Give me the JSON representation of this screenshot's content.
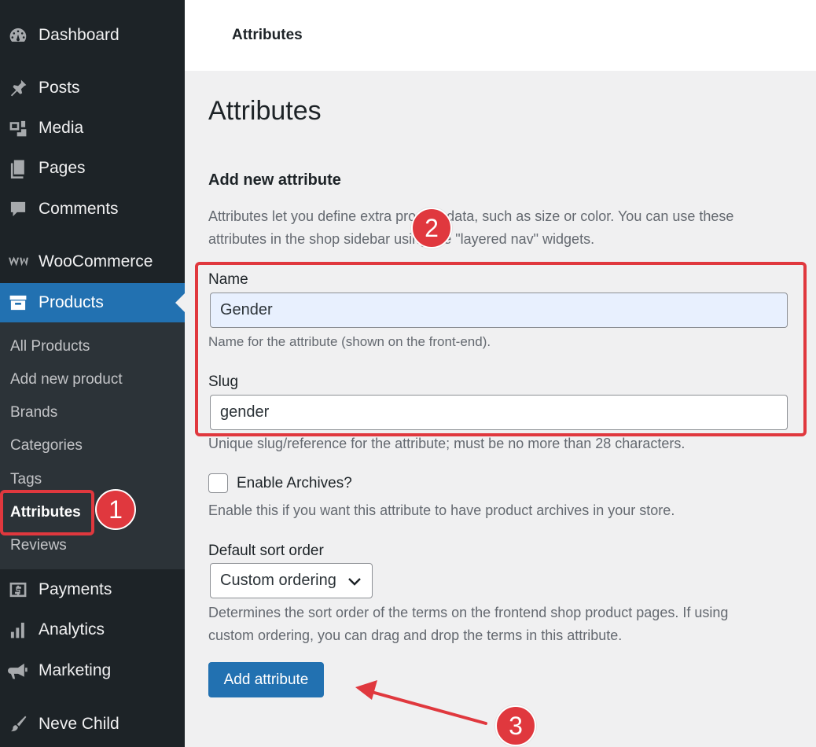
{
  "sidebar": {
    "items": [
      {
        "label": "Dashboard",
        "icon": "dashboard-icon"
      },
      {
        "label": "Posts",
        "icon": "pin-icon"
      },
      {
        "label": "Media",
        "icon": "media-icon"
      },
      {
        "label": "Pages",
        "icon": "pages-icon"
      },
      {
        "label": "Comments",
        "icon": "comment-icon"
      },
      {
        "label": "WooCommerce",
        "icon": "woocommerce-icon"
      },
      {
        "label": "Products",
        "icon": "archive-icon"
      },
      {
        "label": "Payments",
        "icon": "dollar-icon"
      },
      {
        "label": "Analytics",
        "icon": "chart-bar-icon"
      },
      {
        "label": "Marketing",
        "icon": "megaphone-icon"
      },
      {
        "label": "Neve Child",
        "icon": "brush-icon"
      }
    ],
    "submenu": [
      {
        "label": "All Products"
      },
      {
        "label": "Add new product"
      },
      {
        "label": "Brands"
      },
      {
        "label": "Categories"
      },
      {
        "label": "Tags"
      },
      {
        "label": "Attributes"
      },
      {
        "label": "Reviews"
      }
    ]
  },
  "topbar": {
    "title": "Attributes"
  },
  "main": {
    "title": "Attributes",
    "section_title": "Add new attribute",
    "intro_line1": "Attributes let you define extra product data, such as size or color. You can use these",
    "intro_line2": "attributes in the shop sidebar using the \"layered nav\" widgets.",
    "name_label": "Name",
    "name_value": "Gender",
    "name_help": "Name for the attribute (shown on the front-end).",
    "slug_label": "Slug",
    "slug_value": "gender",
    "slug_help": "Unique slug/reference for the attribute; must be no more than 28 characters.",
    "archives_label": "Enable Archives?",
    "archives_checked": false,
    "archives_help": "Enable this if you want this attribute to have product archives in your store.",
    "sort_label": "Default sort order",
    "sort_value": "Custom ordering",
    "sort_help_line1": "Determines the sort order of the terms on the frontend shop product pages. If using",
    "sort_help_line2": "custom ordering, you can drag and drop the terms in this attribute.",
    "submit_label": "Add attribute"
  },
  "annotations": {
    "badge1": "1",
    "badge2": "2",
    "badge3": "3",
    "color": "#e0383e"
  },
  "colors": {
    "sidebar_bg": "#1d2327",
    "submenu_bg": "#2c3338",
    "accent": "#2271b1"
  }
}
